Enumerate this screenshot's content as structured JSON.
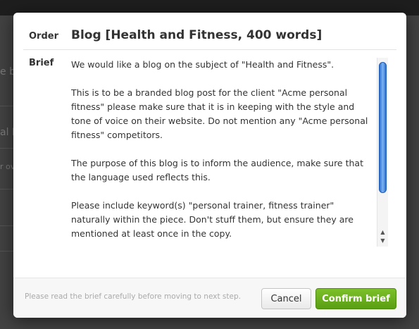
{
  "background": {
    "fragments": [
      "e b",
      "al I",
      "r ov"
    ]
  },
  "order": {
    "label": "Order",
    "title": "Blog [Health and Fitness, 400 words]"
  },
  "brief": {
    "label": "Brief",
    "paragraphs": [
      "We would like a blog on the subject of \"Health and Fitness\".",
      "This is to be a branded blog post for the client \"Acme personal fitness\" please make sure that it is in keeping with the style and tone of voice on their website. Do not mention any \"Acme personal fitness\" competitors.",
      "The purpose of this blog is to inform the audience, make sure that the language used reflects this.",
      "Please include keyword(s) \"personal trainer, fitness trainer\" naturally within the piece. Don't stuff them, but ensure they are mentioned at least once in the copy."
    ],
    "scroll_up_icon": "▲",
    "scroll_down_icon": "▼"
  },
  "footer": {
    "hint": "Please read the brief carefully before moving to next step.",
    "cancel_label": "Cancel",
    "confirm_label": "Confirm brief"
  },
  "colors": {
    "confirm": "#6bb31e",
    "scroll_thumb": "#3a7fd8"
  }
}
